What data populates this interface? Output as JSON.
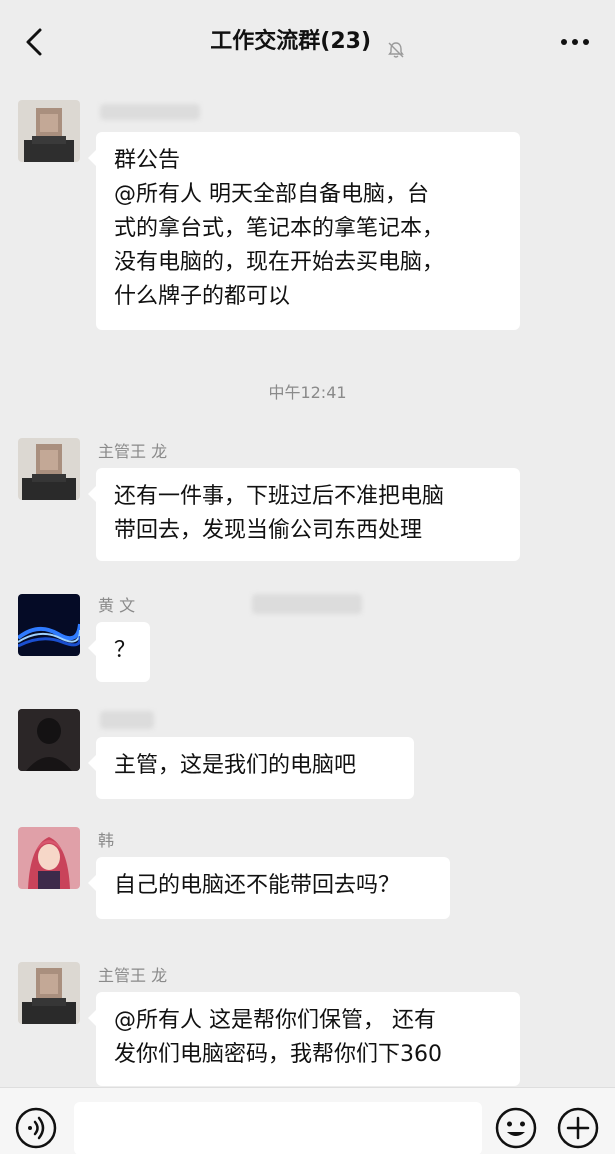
{
  "header": {
    "title": "工作交流群(23)",
    "back_icon": "chevron-left-icon",
    "mute_icon": "bell-muted-icon",
    "more_icon": "more-dots-icon"
  },
  "messages": [
    {
      "sender": "",
      "avatar": "pixelated-person-avatar",
      "lines": [
        "群公告",
        "@所有人  明天全部自备电脑，台",
        "式的拿台式，笔记本的拿笔记本，",
        "没有电脑的，现在开始去买电脑，",
        "什么牌子的都可以"
      ]
    },
    {
      "timestamp": "中午12:41"
    },
    {
      "sender": "主管王 龙",
      "avatar": "pixelated-person-avatar",
      "lines": [
        "还有一件事，下班过后不准把电脑",
        "带回去，发现当偷公司东西处理"
      ]
    },
    {
      "sender": "黄 文",
      "avatar": "blue-wave-avatar",
      "lines": [
        "？"
      ]
    },
    {
      "sender": "",
      "avatar": "dark-silhouette-avatar",
      "lines": [
        "主管，这是我们的电脑吧"
      ]
    },
    {
      "sender": "韩",
      "avatar": "anime-girl-avatar",
      "lines": [
        "自己的电脑还不能带回去吗？"
      ]
    },
    {
      "sender": "主管王 龙",
      "avatar": "pixelated-person-avatar",
      "lines": [
        "@所有人  这是帮你们保管，  还有",
        "发你们电脑密码，我帮你们下360"
      ]
    }
  ],
  "bottom_bar": {
    "voice_icon": "voice-icon",
    "emoji_icon": "emoji-icon",
    "plus_icon": "plus-icon",
    "input_placeholder": ""
  }
}
